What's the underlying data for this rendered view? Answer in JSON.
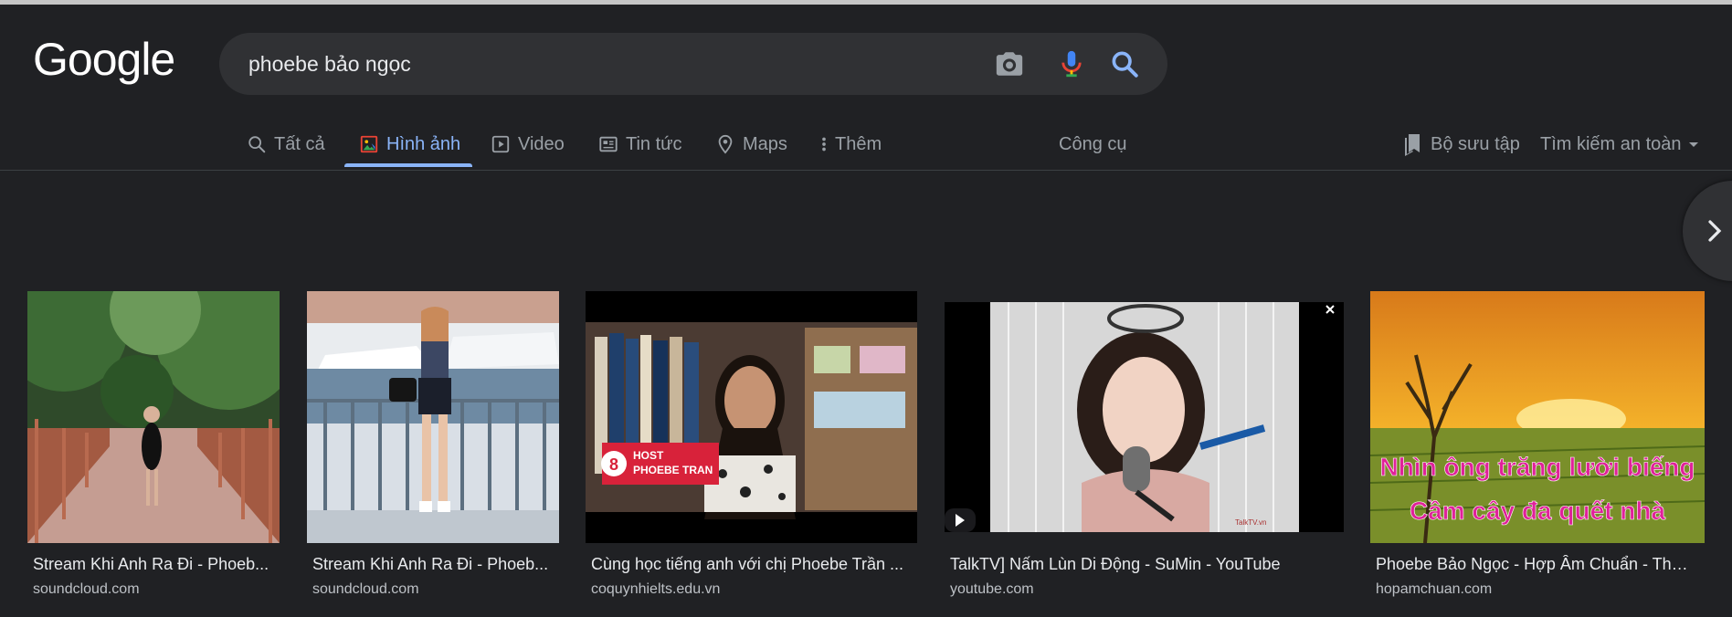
{
  "logo_text": "Google",
  "search": {
    "query": "phoebe bảo ngọc"
  },
  "tabs": [
    {
      "label": "Tất cả"
    },
    {
      "label": "Hình ảnh"
    },
    {
      "label": "Video"
    },
    {
      "label": "Tin tức"
    },
    {
      "label": "Maps"
    },
    {
      "label": "Thêm"
    }
  ],
  "tools_label": "Công cụ",
  "collections_label": "Bộ sưu tập",
  "safe_search_label": "Tìm kiếm an toàn",
  "results": [
    {
      "title": "Stream Khi Anh Ra Đi - Phoeb...",
      "site": "soundcloud.com"
    },
    {
      "title": "Stream Khi Anh Ra Đi - Phoeb...",
      "site": "soundcloud.com"
    },
    {
      "title": "Cùng học tiếng anh với chị Phoebe Trần ...",
      "site": "coquynhielts.edu.vn",
      "overlay_num": "8",
      "overlay_text1": "HOST",
      "overlay_text2": "PHOEBE TRAN"
    },
    {
      "title": "TalkTV] Nấm Lùn Di Động - SuMin - YouTube",
      "site": "youtube.com",
      "watermark": "TalkTV.vn"
    },
    {
      "title": "Phoebe Bảo Ngọc - Hợp Âm Chuẩn - Thư ...",
      "site": "hopamchuan.com",
      "lyric1": "Nhìn ông trăng lười biếng",
      "lyric2": "Cầm cây đa quết nhà"
    }
  ],
  "colors": {
    "background": "#202124",
    "accent": "#8ab4f8",
    "searchbox": "#303134"
  }
}
